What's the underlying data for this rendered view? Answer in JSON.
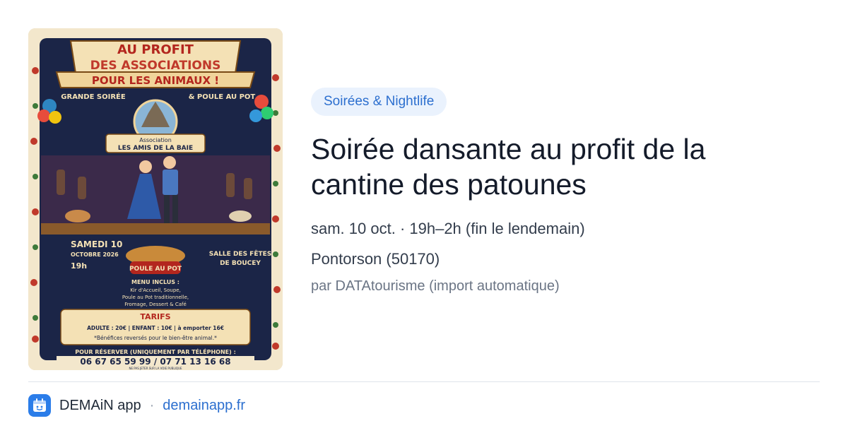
{
  "poster": {
    "header_line1": "AU PROFIT",
    "header_line2": "DES ASSOCIATIONS",
    "header_line3": "POUR LES ANIMAUX !",
    "subtitle_left": "GRANDE SOIRÉE",
    "subtitle_right": "& POULE AU POT",
    "assoc_line1": "Association",
    "assoc_line2": "LES AMIS DE LA BAIE",
    "date_line1": "SAMEDI 10",
    "date_line2": "OCTOBRE 2026",
    "time": "19h",
    "venue_line1": "SALLE DES FÊTES",
    "venue_line2": "DE BOUCEY",
    "dish_label": "POULE AU POT",
    "menu_title": "MENU INCLUS :",
    "menu_line1": "Kir d'Accueil, Soupe,",
    "menu_line2": "Poule au Pot traditionnelle,",
    "menu_line3": "Fromage, Dessert & Café",
    "tarifs_title": "TARIFS",
    "tarifs_line": "ADULTE : 20€ | ENFANT : 10€ | à emporter 16€",
    "tarifs_note": "*Bénéfices reversés pour le bien-être animal.*",
    "reserve_line": "POUR RÉSERVER (UNIQUEMENT PAR TÉLÉPHONE) :",
    "phones": "06 67 65 59 99 / 07 71 13 16 68",
    "fineprint": "NE PAS JETER SUR LA VOIE PUBLIQUE"
  },
  "event": {
    "category": "Soirées & Nightlife",
    "title": "Soirée dansante au profit de la cantine des patounes",
    "datetime": "sam. 10 oct. · 19h–2h (fin le lendemain)",
    "location": "Pontorson (50170)",
    "source": "par DATAtourisme (import automatique)"
  },
  "footer": {
    "app_name": "DEMAiN app",
    "separator": "·",
    "domain": "demainapp.fr"
  },
  "colors": {
    "accent": "#2c6fcf",
    "badge_bg": "#eaf2fd",
    "poster_bg": "#f3e7cc",
    "poster_dark": "#1b2547",
    "poster_red": "#b3261e"
  }
}
